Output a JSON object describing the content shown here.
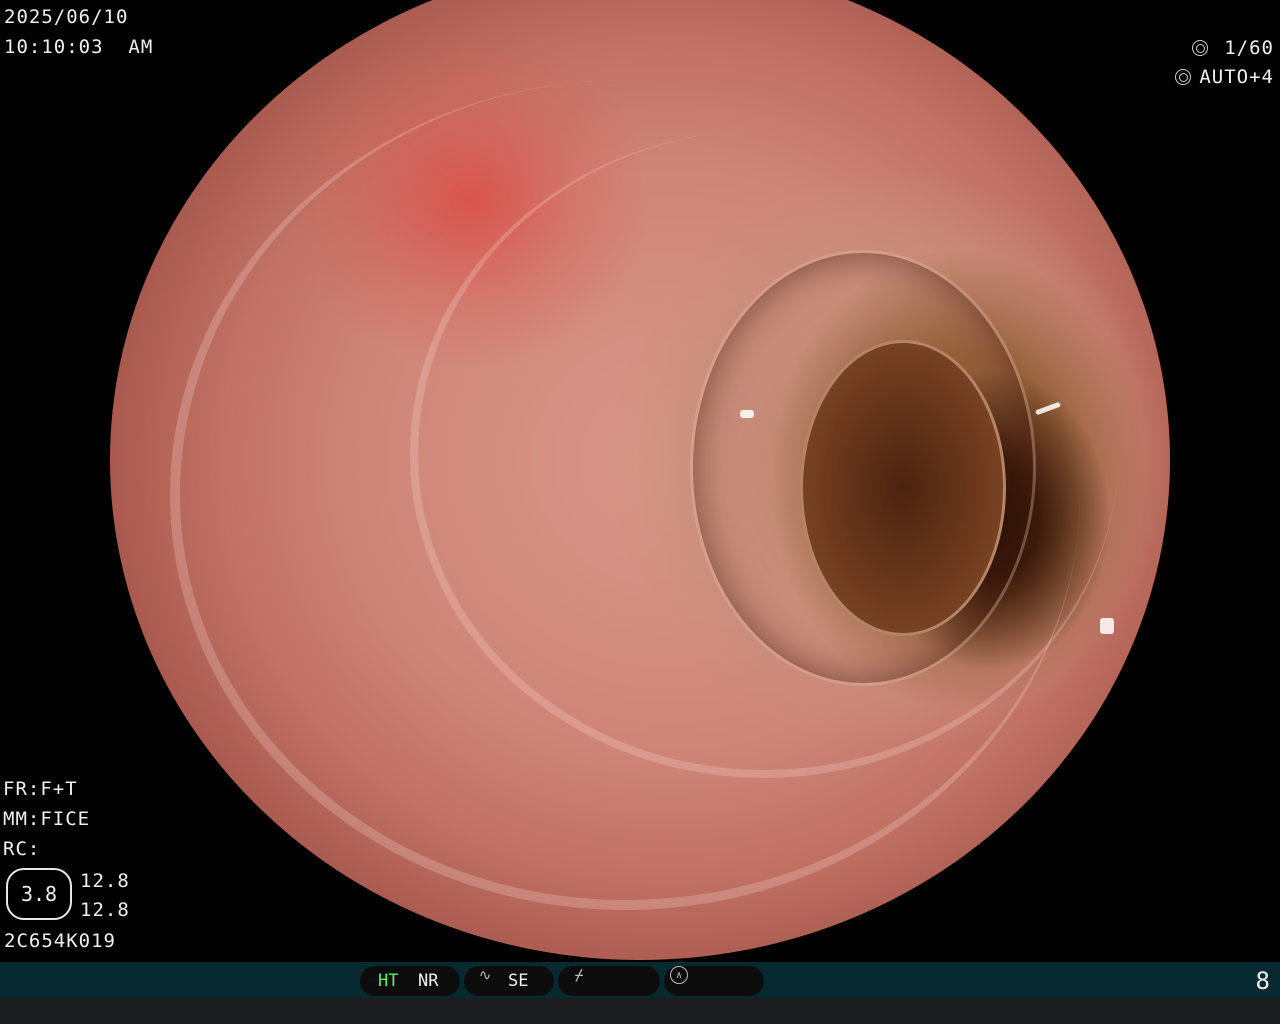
{
  "overlay": {
    "date": "2025/06/10",
    "time": "10:10:03  AM",
    "shutter": "1/60",
    "iris": "AUTO+4",
    "fr": "FR:F+T",
    "mm": "MM:FICE",
    "rc": "RC:",
    "gauge_value": "3.8",
    "value_a": "12.8",
    "value_b": "12.8",
    "scope_id": "2C654K019"
  },
  "status_bar": {
    "ht": "HT",
    "nr": "NR",
    "se": "SE",
    "page": "8"
  },
  "icons": {
    "shutter": "shutter-icon",
    "iris": "iris-icon",
    "wave": "wave-icon",
    "slash": "slash-icon",
    "dial": "dial-icon"
  },
  "colors": {
    "ht_active": "#5ef05e",
    "bar_background": "#062a30"
  }
}
